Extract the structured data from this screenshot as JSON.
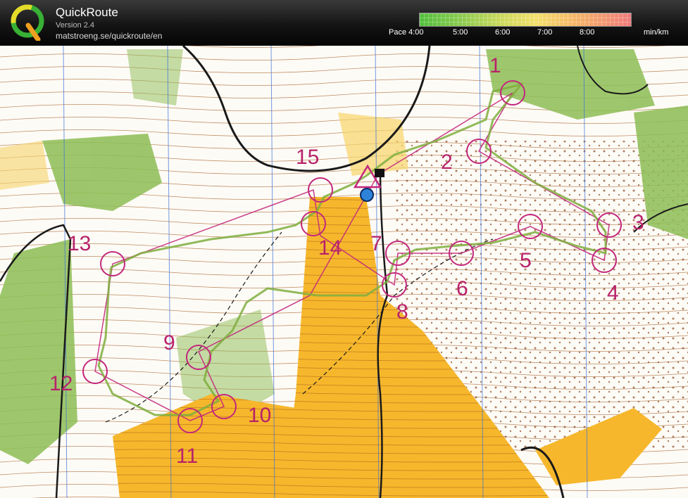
{
  "app": {
    "title": "QuickRoute",
    "version": "Version 2.4",
    "url": "matstroeng.se/quickroute/en",
    "logo_icon": "quickroute-q-logo-icon"
  },
  "pace_scale": {
    "label_prefix": "Pace 4:00",
    "labels": [
      "5:00",
      "6:00",
      "7:00",
      "8:00"
    ],
    "unit": "min/km",
    "colors": [
      "#4fbf3a",
      "#c9d85a",
      "#f4e06a",
      "#f5b266",
      "#f07a7a"
    ]
  },
  "map": {
    "controls": [
      {
        "num": "1"
      },
      {
        "num": "2"
      },
      {
        "num": "3"
      },
      {
        "num": "4"
      },
      {
        "num": "5"
      },
      {
        "num": "6"
      },
      {
        "num": "7"
      },
      {
        "num": "8"
      },
      {
        "num": "9"
      },
      {
        "num": "10"
      },
      {
        "num": "11"
      },
      {
        "num": "12"
      },
      {
        "num": "13"
      },
      {
        "num": "14"
      },
      {
        "num": "15"
      }
    ],
    "colors": {
      "course": "#c3277c",
      "open_land": "#f6b72c",
      "vegetation": "#8dbd55",
      "contour": "#a8642e",
      "north_lines": "#3a6fd8"
    }
  }
}
